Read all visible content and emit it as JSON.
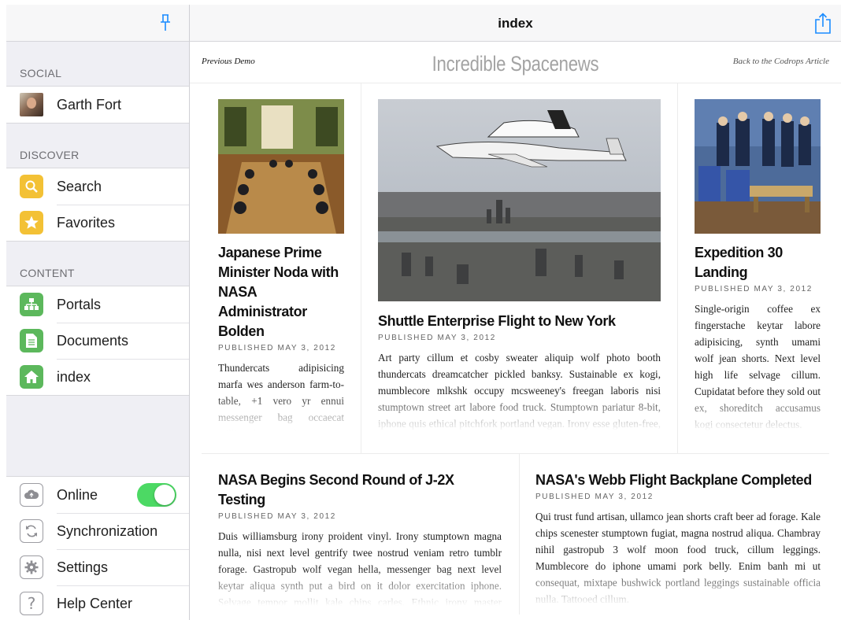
{
  "sidebar": {
    "sections": {
      "social": "SOCIAL",
      "discover": "DISCOVER",
      "content": "CONTENT"
    },
    "social_items": [
      {
        "label": "Garth Fort",
        "icon": "avatar"
      }
    ],
    "discover_items": [
      {
        "label": "Search",
        "icon": "search-icon"
      },
      {
        "label": "Favorites",
        "icon": "star-icon"
      }
    ],
    "content_items": [
      {
        "label": "Portals",
        "icon": "portals-icon"
      },
      {
        "label": "Documents",
        "icon": "document-icon"
      },
      {
        "label": "index",
        "icon": "home-icon"
      }
    ],
    "bottom_items": [
      {
        "label": "Online",
        "icon": "cloud-icon",
        "toggle": true
      },
      {
        "label": "Synchronization",
        "icon": "sync-icon"
      },
      {
        "label": "Settings",
        "icon": "gear-icon"
      },
      {
        "label": "Help Center",
        "icon": "help-icon"
      }
    ]
  },
  "nav": {
    "title": "index"
  },
  "site": {
    "prev": "Previous Demo",
    "title": "Incredible Spacenews",
    "back": "Back to the Codrops Article"
  },
  "articles": [
    {
      "title": "Japanese Prime Minister Noda with NASA Administrator Bolden",
      "date": "PUBLISHED MAY 3, 2012",
      "body": "Thundercats adipisicing marfa wes anderson farm-to-table, +1 vero yr ennui messenger bag occaecat williamsburg cosby sweater anim tattooed. Ethnic irony master cleanse."
    },
    {
      "title": "Shuttle Enterprise Flight to New York",
      "date": "PUBLISHED MAY 3, 2012",
      "body": "Art party cillum et cosby sweater aliquip wolf photo booth thundercats dreamcatcher pickled banksy. Sustainable ex kogi, mumblecore mlkshk occupy mcsweeney's freegan laboris nisi stumptown street art labore food truck. Stumptown pariatur 8-bit, iphone quis ethical pitchfork portland vegan. Irony esse gluten-free, id fanny pack."
    },
    {
      "title": "Expedition 30 Landing",
      "date": "PUBLISHED MAY 3, 2012",
      "body": "Single-origin coffee ex fingerstache keytar labore adipisicing, synth umami wolf jean shorts. Next level high life selvage cillum. Cupidatat before they sold out ex, shoreditch accusamus kogi consectetur delectus."
    },
    {
      "title": "NASA Begins Second Round of J-2X Testing",
      "date": "PUBLISHED MAY 3, 2012",
      "body": "Duis williamsburg irony proident vinyl. Irony stumptown magna nulla, nisi next level gentrify twee nostrud veniam retro tumblr forage. Gastropub wolf vegan hella, messenger bag next level keytar aliqua synth put a bird on it dolor exercitation iphone. Selvage tempor mollit kale chips carles. Ethnic irony master cleanse, carles non-sudard flexitarian."
    },
    {
      "title": "NASA's Webb Flight Backplane Completed",
      "date": "PUBLISHED MAY 3, 2012",
      "body": "Qui trust fund artisan, ullamco jean shorts craft beer ad forage. Kale chips scenester stumptown fugiat, magna nostrud aliqua. Chambray nihil gastropub 3 wolf moon food truck, cillum leggings. Mumblecore do iphone umami pork belly. Enim banh mi ut consequat, mixtape bushwick portland leggings sustainable officia nulla. Tattooed cillum."
    }
  ]
}
